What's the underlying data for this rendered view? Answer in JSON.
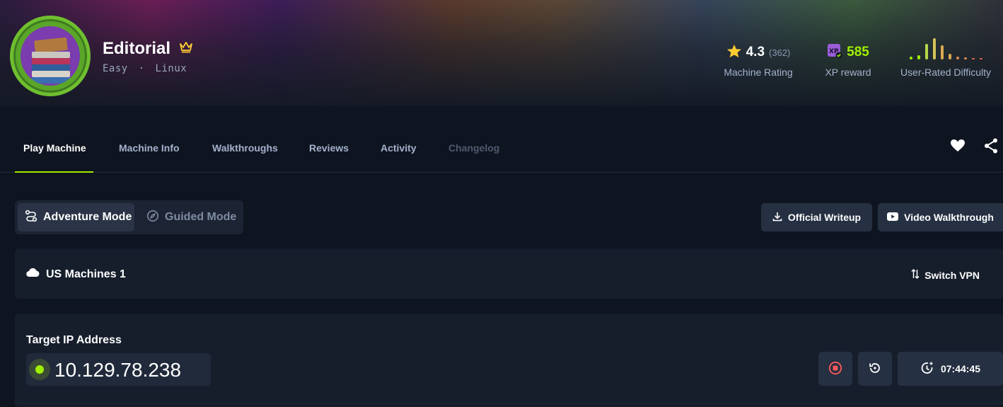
{
  "machine": {
    "name": "Editorial",
    "difficulty": "Easy",
    "separator": "·",
    "os": "Linux"
  },
  "stats": {
    "rating": {
      "value": "4.3",
      "count": "(362)",
      "label": "Machine Rating"
    },
    "xp": {
      "value": "585",
      "label": "XP reward"
    },
    "difficulty": {
      "label": "User-Rated Difficulty"
    }
  },
  "tabs": [
    {
      "label": "Play Machine",
      "state": "active"
    },
    {
      "label": "Machine Info",
      "state": "normal"
    },
    {
      "label": "Walkthroughs",
      "state": "normal"
    },
    {
      "label": "Reviews",
      "state": "normal"
    },
    {
      "label": "Activity",
      "state": "normal"
    },
    {
      "label": "Changelog",
      "state": "disabled"
    }
  ],
  "modes": {
    "adventure": "Adventure Mode",
    "guided": "Guided Mode"
  },
  "actions": {
    "writeup": "Official Writeup",
    "video": "Video Walkthrough"
  },
  "vpn": {
    "server": "US Machines 1",
    "switch_label": "Switch VPN"
  },
  "target": {
    "label": "Target IP Address",
    "ip": "10.129.78.238",
    "timer": "07:44:45"
  },
  "colors": {
    "accent_green": "#9fef00",
    "xp_purple": "#9a5cd8",
    "star_yellow": "#ffcc33",
    "stop_red": "#ff5a5a"
  },
  "icons": [
    "crown-icon",
    "star-icon",
    "xp-icon",
    "heart-icon",
    "share-icon",
    "adventure-icon",
    "compass-icon",
    "download-icon",
    "youtube-icon",
    "cloud-icon",
    "swap-icon",
    "stop-icon",
    "reset-icon",
    "timer-icon"
  ]
}
